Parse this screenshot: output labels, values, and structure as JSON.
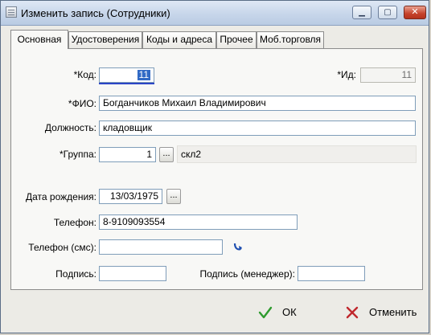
{
  "window": {
    "title": "Изменить запись (Сотрудники)",
    "min_symbol": "▁",
    "max_symbol": "▢",
    "close_symbol": "✕"
  },
  "tabs": [
    {
      "label": "Основная",
      "active": true
    },
    {
      "label": "Удостоверения",
      "active": false
    },
    {
      "label": "Коды и адреса",
      "active": false
    },
    {
      "label": "Прочее",
      "active": false
    },
    {
      "label": "Моб.торговля",
      "active": false
    }
  ],
  "form": {
    "code": {
      "label": "*Код:",
      "value": "11"
    },
    "id": {
      "label": "*Ид:",
      "value": "11"
    },
    "fio": {
      "label": "*ФИО:",
      "value": "Богданчиков Михаил Владимирович"
    },
    "position": {
      "label": "Должность:",
      "value": "кладовщик"
    },
    "group": {
      "label": "*Группа:",
      "value": "1",
      "button": "...",
      "name": "скл2"
    },
    "birth_date": {
      "label": "Дата рождения:",
      "value": "13/03/1975",
      "button": "..."
    },
    "phone": {
      "label": "Телефон:",
      "value": "8-9109093554"
    },
    "phone_sms": {
      "label": "Телефон (смс):",
      "value": ""
    },
    "signature": {
      "label": "Подпись:",
      "value": ""
    },
    "signature_manager": {
      "label": "Подпись (менеджер):",
      "value": ""
    }
  },
  "buttons": {
    "ok": {
      "label": "ОК",
      "icon": "check-icon",
      "color": "#2e9b2e"
    },
    "cancel": {
      "label": "Отменить",
      "icon": "cross-icon",
      "color": "#c0282d"
    }
  }
}
